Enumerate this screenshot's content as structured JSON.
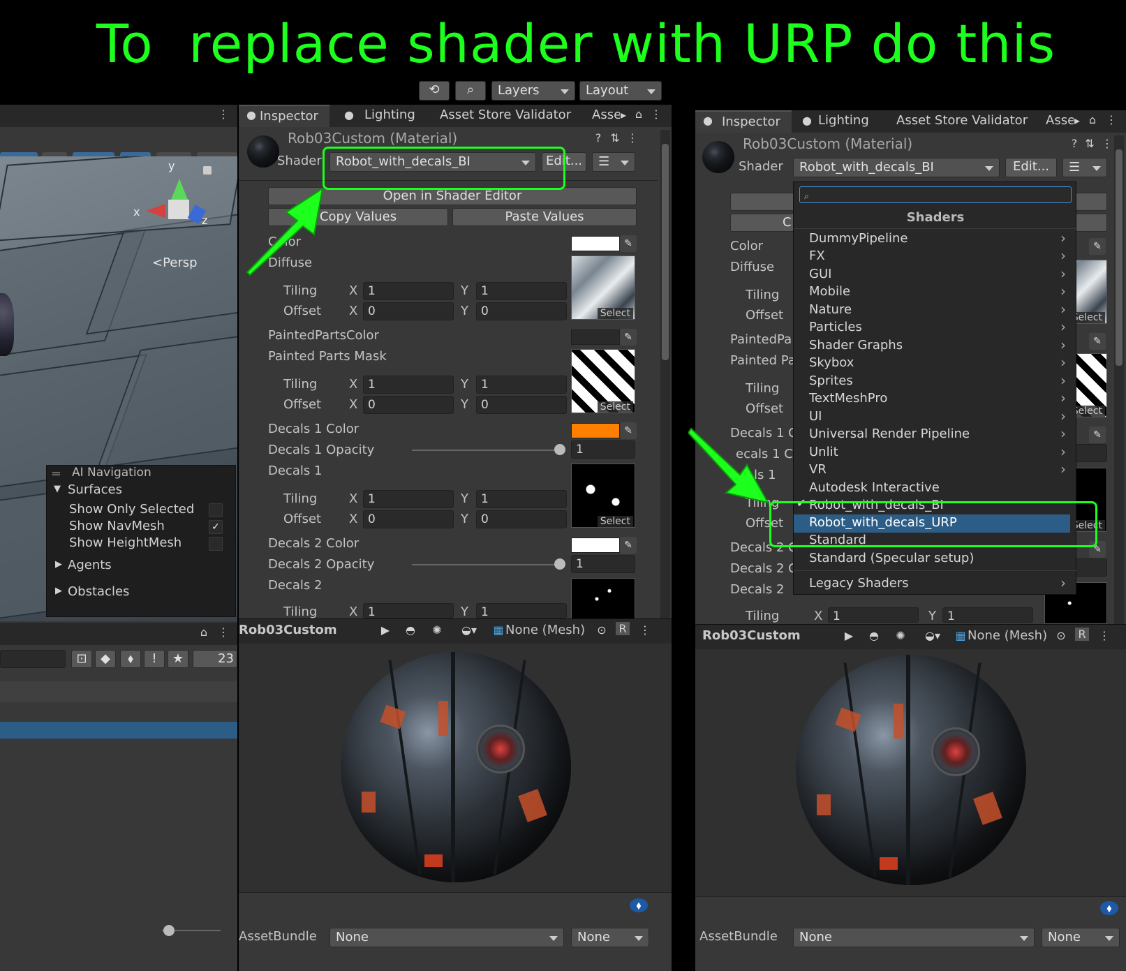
{
  "title": "To  replace shader with URP do this",
  "top_toolbar": {
    "layers": "Layers",
    "layout": "Layout"
  },
  "scene": {
    "persp": "<Persp",
    "axis_x": "x",
    "axis_y": "y",
    "axis_z": "z",
    "overlay": {
      "title": "AI Navigation",
      "surfaces": "Surfaces",
      "show_only_selected": "Show Only Selected",
      "show_navmesh": "Show NavMesh",
      "show_heightmesh": "Show HeightMesh",
      "agents": "Agents",
      "obstacles": "Obstacles",
      "navmesh_checked": true
    },
    "hidden_count": "23"
  },
  "inspector_left": {
    "tabs": [
      "Inspector",
      "Lighting",
      "Asset Store Validator",
      "Asse"
    ],
    "material_name": "Rob03Custom (Material)",
    "shader_label": "Shader",
    "shader_value": "Robot_with_decals_BI",
    "edit_button": "Edit...",
    "open_shader_editor": "Open in Shader Editor",
    "copy_values": "Copy Values",
    "paste_values": "Paste Values",
    "props": {
      "color": "Color",
      "diffuse": "Diffuse",
      "tiling": "Tiling",
      "offset": "Offset",
      "x": "X",
      "y": "Y",
      "one": "1",
      "zero": "0",
      "painted_color": "PaintedPartsColor",
      "painted_mask": "Painted Parts Mask",
      "decals1_color": "Decals 1 Color",
      "decals1_opacity": "Decals 1 Opacity",
      "decals1": "Decals 1",
      "decals2_color": "Decals 2 Color",
      "decals2_opacity": "Decals 2 Opacity",
      "decals2": "Decals 2",
      "select": "Select"
    },
    "preview_name": "Rob03Custom",
    "preview_mesh": "None (Mesh)",
    "asset_bundle_label": "AssetBundle",
    "asset_bundle_value": "None",
    "asset_bundle_variant": "None",
    "colors": {
      "color": "#ffffff",
      "painted": "#2a2a2a",
      "decals1": "#ff8000",
      "decals2": "#ffffff"
    }
  },
  "inspector_right": {
    "tabs": [
      "Inspector",
      "Lighting",
      "Asset Store Validator",
      "Asse"
    ],
    "material_name": "Rob03Custom (Material)",
    "shader_label": "Shader",
    "shader_value": "Robot_with_decals_BI",
    "edit_button": "Edit...",
    "props": {
      "color": "Color",
      "diffuse": "Diffuse",
      "tiling": "Tiling",
      "offset": "Offset",
      "painted1": "PaintedPa",
      "painted2": "Painted Pa",
      "decals1c": "Decals 1 C",
      "decals1o": "ecals 1 C",
      "decals1": "ls 1",
      "decals2c": "Decals 2 C",
      "decals2o": "Decals 2 C",
      "decals2": "Decals 2",
      "x": "X",
      "y": "Y",
      "one": "1",
      "select": "Select",
      "c_btn": "C"
    },
    "preview_name": "Rob03Custom",
    "preview_mesh": "None (Mesh)",
    "asset_bundle_label": "AssetBundle",
    "asset_bundle_value": "None",
    "asset_bundle_variant": "None"
  },
  "shader_menu": {
    "search_placeholder": "",
    "header": "Shaders",
    "items": [
      "DummyPipeline",
      "FX",
      "GUI",
      "Mobile",
      "Nature",
      "Particles",
      "Shader Graphs",
      "Skybox",
      "Sprites",
      "TextMeshPro",
      "UI",
      "Universal Render Pipeline",
      "Unlit",
      "VR",
      "Autodesk Interactive",
      "Robot_with_decals_BI",
      "Robot_with_decals_URP",
      "Standard",
      "Standard (Specular setup)",
      "Legacy Shaders"
    ],
    "selected": "Robot_with_decals_URP",
    "checked": "Robot_with_decals_BI"
  },
  "accent_green": "#1dff1d",
  "selection_blue": "#2c5d87"
}
